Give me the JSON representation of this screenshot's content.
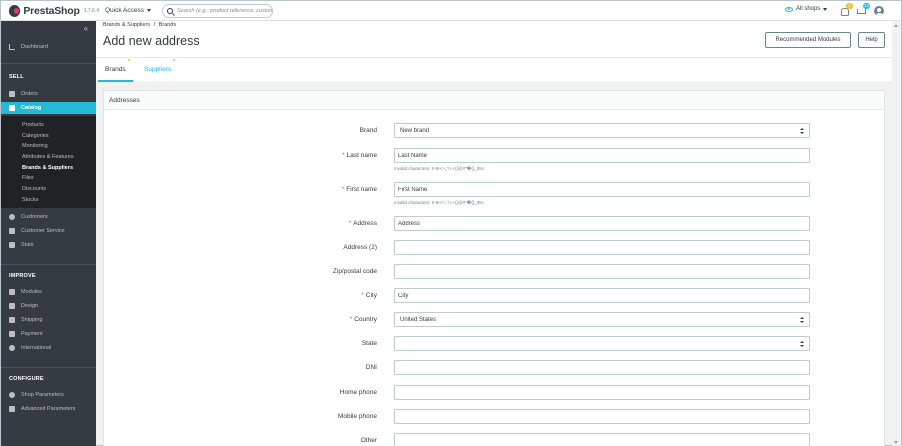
{
  "topbar": {
    "brand": "PrestaShop",
    "version": "1.7.6.4",
    "quick_access": "Quick Access",
    "search_placeholder": "Search (e.g.: product reference, customer name...)",
    "shops_label": "All shops",
    "notifications_count": "2",
    "orders_count": "12"
  },
  "sidebar": {
    "dashboard": "Dashboard",
    "sections": {
      "sell": "SELL",
      "improve": "IMPROVE",
      "configure": "CONFIGURE"
    },
    "sell_items": [
      "Orders",
      "Catalog"
    ],
    "catalog_sub": [
      "Products",
      "Categories",
      "Monitoring",
      "Attributes & Features",
      "Brands & Suppliers",
      "Files",
      "Discounts",
      "Stocks"
    ],
    "sell_items_after": [
      "Customers",
      "Customer Service",
      "Stats"
    ],
    "improve_items": [
      "Modules",
      "Design",
      "Shipping",
      "Payment",
      "International"
    ],
    "configure_items": [
      "Shop Parameters",
      "Advanced Parameters"
    ]
  },
  "header": {
    "breadcrumb_1": "Brands & Suppliers",
    "breadcrumb_sep": "/",
    "breadcrumb_2": "Brands",
    "title": "Add new address",
    "btn_recommended": "Recommended Modules",
    "btn_help": "Help",
    "tab_brands": "Brands",
    "tab_suppliers": "Suppliers"
  },
  "form": {
    "panel_title": "Addresses",
    "brand_label": "Brand",
    "brand_value": "New brand",
    "lastname_label": "Last name",
    "lastname_value": "Last Name",
    "lastname_hint": "Invalid characters: 0-9!<>,;?=+()@#\"�{}_$%:",
    "firstname_label": "First name",
    "firstname_value": "First Name",
    "firstname_hint": "Invalid characters: 0-9!<>,;?=+()@#\"�{}_$%:",
    "address_label": "Address",
    "address_value": "Address",
    "address2_label": "Address (2)",
    "zip_label": "Zip/postal code",
    "city_label": "City",
    "city_value": "City",
    "country_label": "Country",
    "country_value": "United States",
    "state_label": "State",
    "dni_label": "DNI",
    "homephone_label": "Home phone",
    "mobilephone_label": "Mobile phone",
    "other_label": "Other",
    "required_mark": "*"
  }
}
